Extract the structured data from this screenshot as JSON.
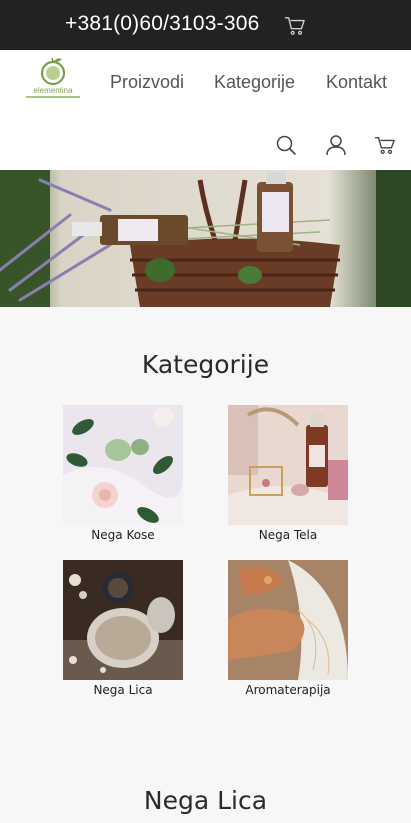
{
  "topbar": {
    "phone": "+381(0)60/3103-306",
    "cart_icon": "cart-icon"
  },
  "header": {
    "logo_text": "elementina",
    "nav": [
      "Proizvodi",
      "Kategorije",
      "Kontakt"
    ],
    "icons": [
      "search-icon",
      "account-icon",
      "cart-icon"
    ]
  },
  "categories_section": {
    "title": "Kategorije",
    "items": [
      {
        "label": "Nega Kose"
      },
      {
        "label": "Nega Tela"
      },
      {
        "label": "Nega Lica"
      },
      {
        "label": "Aromaterapija"
      }
    ]
  },
  "next_section": {
    "title": "Nega Lica"
  },
  "colors": {
    "topbar": "#222222",
    "accent": "#7ba04d",
    "background": "#f7f7f7"
  }
}
